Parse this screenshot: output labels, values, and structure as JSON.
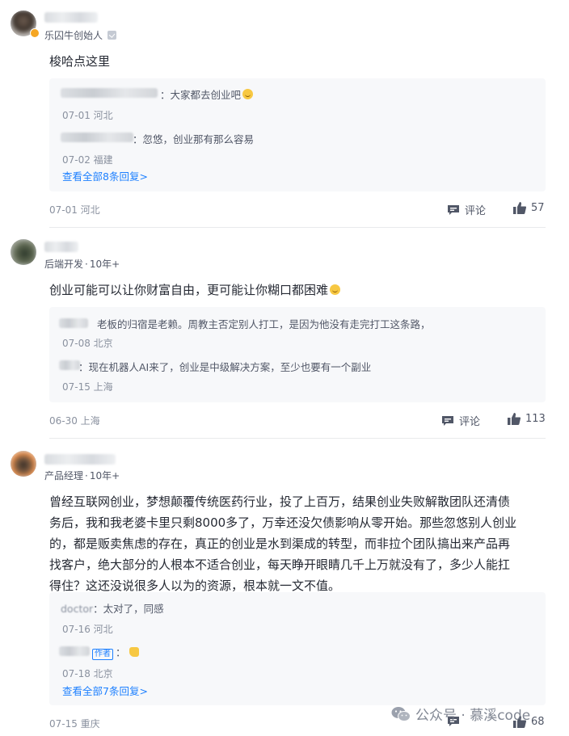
{
  "comments": [
    {
      "role": "乐囚牛创始人",
      "content": "梭哈点这里",
      "replies": [
        {
          "text": "：大家都去创业吧",
          "meta": "07-01 河北"
        },
        {
          "text": "：忽悠，创业那有那么容易",
          "meta": "07-02 福建"
        }
      ],
      "view_all": "查看全部8条回复>",
      "date": "07-01 河北",
      "comment_label": "评论",
      "likes": "57"
    },
    {
      "role": "后端开发",
      "years": "10年+",
      "content": "创业可能可以让你财富自由，更可能让你糊口都困难",
      "replies": [
        {
          "text": "老板的归宿是老赖。周教主否定别人打工，是因为他没有走完打工这条路，",
          "meta": "07-08 北京"
        },
        {
          "text": "：现在机器人AI来了，创业是中级解决方案，至少也要有一个副业",
          "meta": "07-15 上海"
        }
      ],
      "date": "06-30 上海",
      "comment_label": "评论",
      "likes": "113"
    },
    {
      "role": "产品经理",
      "years": "10年+",
      "content_lines": [
        "曾经互联网创业，梦想颠覆传统医药行业，投了上百万，结果创业失败解散团队还清债",
        "务后，我和我老婆卡里只剩8000多了，万幸还没欠债影响从零开始。那些忽悠别人创业",
        "的，都是贩卖焦虑的存在，真正的创业是水到渠成的转型，而非拉个团队搞出来产品再",
        "找客户，绝大部分的人根本不适合创业，每天睁开眼睛几千上万就没有了，多少人能扛",
        "得住？这还没说很多人以为的资源，根本就一文不值。"
      ],
      "replies": [
        {
          "name": "doctor",
          "text": "：太对了，同感",
          "meta": "07-16 河北"
        },
        {
          "author_tag": "作者",
          "text": "：",
          "meta": "07-18 北京"
        }
      ],
      "view_all": "查看全部7条回复>",
      "date": "07-15 重庆",
      "likes": "68"
    }
  ],
  "watermark": "公众号 · 慕溪code",
  "colors": {
    "link": "#1e80ff",
    "text": "#252933",
    "muted": "#8a919f",
    "reply_bg": "#f7f8fa"
  },
  "icons": [
    "comment-icon",
    "thumb-up-icon",
    "verified-icon",
    "wechat-icon"
  ]
}
